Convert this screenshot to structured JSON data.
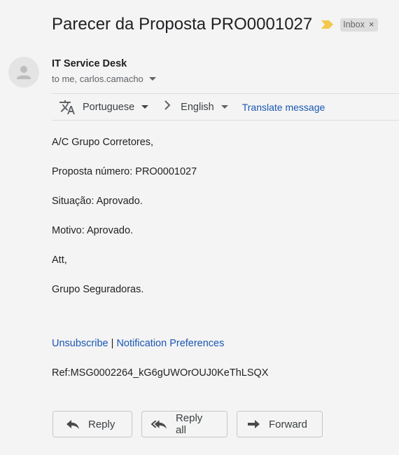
{
  "header": {
    "subject": "Parecer da Proposta PRO0001027",
    "label": "Inbox",
    "label_close": "×"
  },
  "message": {
    "sender_name": "IT Service Desk",
    "recipients": "to me, carlos.camacho"
  },
  "translate_bar": {
    "source_language": "Portuguese",
    "target_language": "English",
    "translate_link": "Translate message"
  },
  "body": {
    "lines": [
      "A/C Grupo Corretores,",
      "Proposta número: PRO0001027",
      "Situação: Aprovado.",
      "Motivo: Aprovado.",
      "Att,",
      "Grupo Seguradoras."
    ],
    "unsubscribe_link": "Unsubscribe",
    "separator": "|",
    "notification_link": "Notification Preferences",
    "ref": "Ref:MSG0002264_kG6gUWOrOUJ0KeThLSQX"
  },
  "actions": {
    "reply": "Reply",
    "reply_all": "Reply all",
    "forward": "Forward"
  },
  "colors": {
    "background": "#f4f4f4",
    "link": "#1a56b4",
    "importance": "#f2c94c",
    "chip_bg": "#dddddd"
  },
  "icons": {
    "importance": "importance-marker-icon",
    "avatar": "person-icon",
    "translate": "translate-icon",
    "reply": "reply-icon",
    "reply_all": "reply-all-icon",
    "forward": "forward-icon"
  }
}
